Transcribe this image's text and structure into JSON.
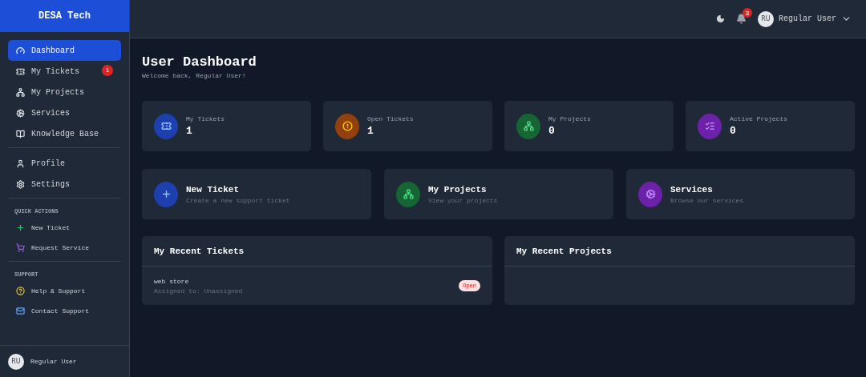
{
  "sidebar": {
    "brand": "DESA Tech",
    "groups": [
      {
        "items": [
          {
            "label": "Dashboard",
            "kind": "gauge",
            "selected": true
          },
          {
            "label": "My Tickets",
            "kind": "ticket",
            "selected": false,
            "badge": "1"
          },
          {
            "label": "My Projects",
            "kind": "network",
            "selected": false
          },
          {
            "label": "Services",
            "kind": "cogs",
            "selected": false
          },
          {
            "label": "Knowledge Base",
            "kind": "book",
            "selected": false
          }
        ]
      },
      {
        "items": [
          {
            "label": "Profile",
            "kind": "user",
            "selected": false
          },
          {
            "label": "Settings",
            "kind": "gear",
            "selected": false
          }
        ]
      },
      {
        "heading": "QUICK ACTIONS",
        "items": [
          {
            "label": "New Ticket",
            "kind": "plus",
            "selected": false
          },
          {
            "label": "Request Service",
            "kind": "cart",
            "selected": false
          }
        ]
      },
      {
        "heading": "SUPPORT",
        "items": [
          {
            "label": "Help & Support",
            "kind": "help",
            "selected": false
          },
          {
            "label": "Contact Support",
            "kind": "mail",
            "selected": false
          }
        ]
      }
    ],
    "user": {
      "initials": "RU",
      "name": "Regular User"
    }
  },
  "header": {
    "notifications": "3",
    "user": {
      "initials": "RU",
      "name": "Regular User"
    }
  },
  "page": {
    "title": "User Dashboard",
    "subtitle": "Welcome back, Regular User!"
  },
  "stats": [
    {
      "label": "My Tickets",
      "value": "1",
      "kind": "ticket"
    },
    {
      "label": "Open Tickets",
      "value": "1",
      "kind": "alert"
    },
    {
      "label": "My Projects",
      "value": "0",
      "kind": "network"
    },
    {
      "label": "Active Projects",
      "value": "0",
      "kind": "list"
    }
  ],
  "actions": [
    {
      "title": "New Ticket",
      "description": "Create a new support ticket",
      "kind": "plus"
    },
    {
      "title": "My Projects",
      "description": "View your projects",
      "kind": "network"
    },
    {
      "title": "Services",
      "description": "Browse our services",
      "kind": "cogs"
    }
  ],
  "recent_tickets": {
    "title": "My Recent Tickets",
    "items": [
      {
        "title": "web store",
        "assignee": "Assigned to: Unassigned",
        "status": "Open"
      }
    ]
  },
  "recent_projects": {
    "title": "My Recent Projects"
  }
}
